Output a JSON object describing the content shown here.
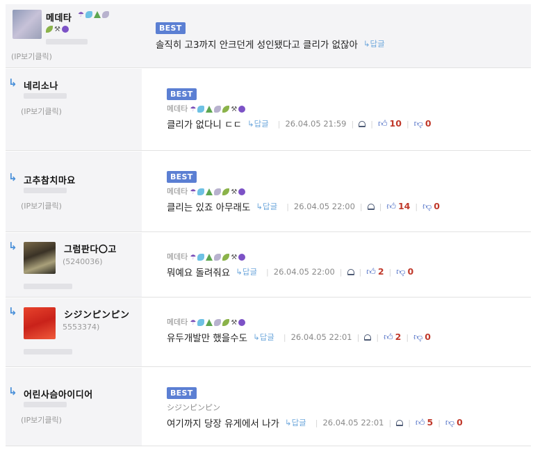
{
  "ip_click_label": "(IP보기클릭)",
  "best_label": "BEST",
  "reply_label": "답글",
  "top_comment": {
    "nick": "메데타",
    "text": "솔직히 고3까지 안크던게 성인됐다고 클리가 없잖아"
  },
  "replies": [
    {
      "nick": "네리소나",
      "show_ip": true,
      "best": true,
      "meta_nick": "메데타",
      "meta_badges": true,
      "text": "클리가 없다니 ㄷㄷ",
      "date": "26.04.05 21:59",
      "up": "10",
      "down": "0"
    },
    {
      "nick": "고추참치마요",
      "show_ip": true,
      "best": true,
      "meta_nick": "메데타",
      "meta_badges": true,
      "text": "클리는 있죠 아무래도",
      "date": "26.04.05 22:00",
      "up": "14",
      "down": "0"
    },
    {
      "nick": "그럼판다〇고",
      "user_id": "(5240036)",
      "best": false,
      "meta_nick": "메데타",
      "meta_badges": true,
      "text": "뭐예요 돌려줘요",
      "date": "26.04.05 22:00",
      "up": "2",
      "down": "0"
    },
    {
      "nick": "シジンピンピン",
      "user_id": "5553374)",
      "best": false,
      "meta_nick": "메데타",
      "meta_badges": true,
      "text": "유두개발만 했을수도",
      "date": "26.04.05 22:01",
      "up": "2",
      "down": "0"
    },
    {
      "nick": "어린사슴아이디어",
      "show_ip": true,
      "best": true,
      "meta_nick": "シジンピンピン",
      "meta_badges": false,
      "text": "여기까지 당장 유게에서 나가",
      "date": "26.04.05 22:01",
      "up": "5",
      "down": "0"
    }
  ],
  "colors": {
    "best_bg": "#5b7fd3",
    "reply_arrow": "#4a90d9",
    "count": "#c0392b",
    "left_panel": "#f4f4f6"
  }
}
